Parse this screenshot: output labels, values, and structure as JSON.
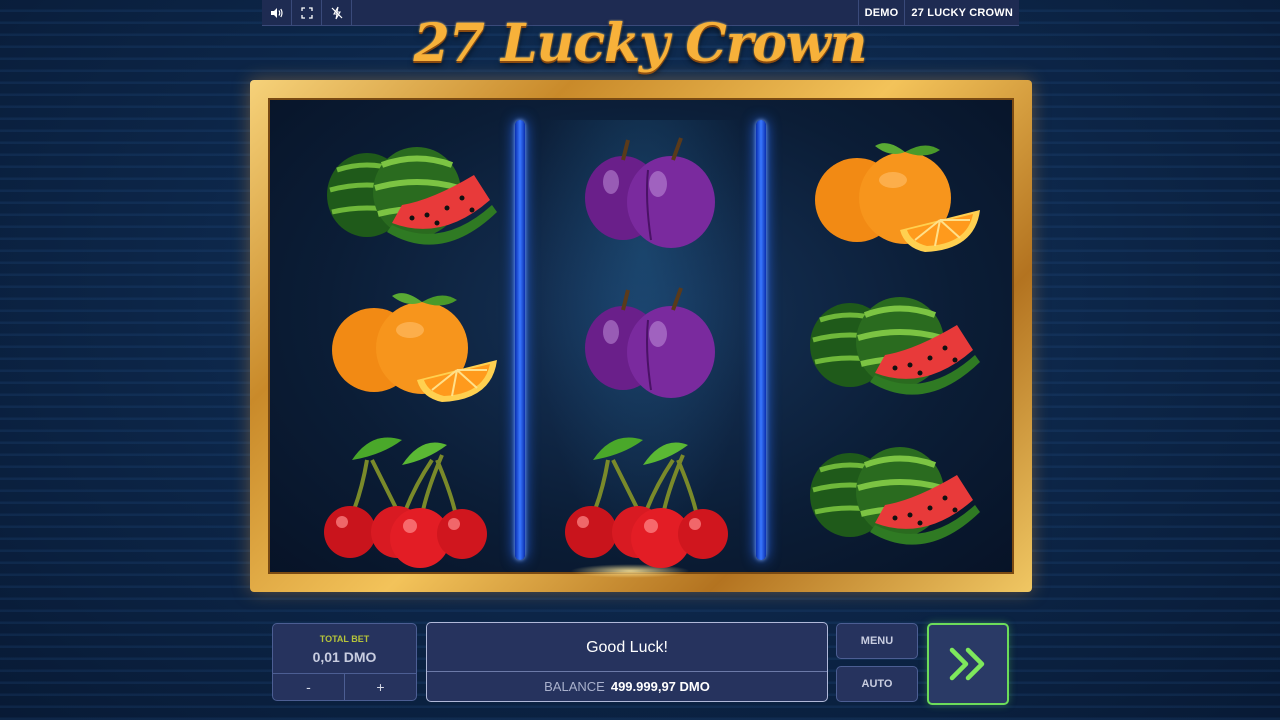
{
  "topbar": {
    "icons": [
      "speaker-icon",
      "fullscreen-icon",
      "turbo-off-icon"
    ],
    "mode_label": "DEMO",
    "game_label": "27 LUCKY CROWN"
  },
  "game": {
    "title": "27 Lucky Crown",
    "reels": [
      [
        "watermelon",
        "orange",
        "cherries"
      ],
      [
        "plums",
        "plums",
        "cherries"
      ],
      [
        "orange",
        "watermelon",
        "watermelon"
      ]
    ]
  },
  "controls": {
    "total_bet_label": "TOTAL BET",
    "total_bet_value": "0,01 DMO",
    "decrease_label": "-",
    "increase_label": "+",
    "message": "Good Luck!",
    "balance_label": "BALANCE",
    "balance_value": "499.999,97 DMO",
    "menu_label": "MENU",
    "auto_label": "AUTO",
    "spin_icon": "double-chevron-right-icon"
  },
  "colors": {
    "background": "#0b2244",
    "frame_gold": "#f3c35a",
    "divider_blue": "#3a78ff",
    "spin_green": "#6cdc5a",
    "title_gold": "#f7b13a"
  }
}
